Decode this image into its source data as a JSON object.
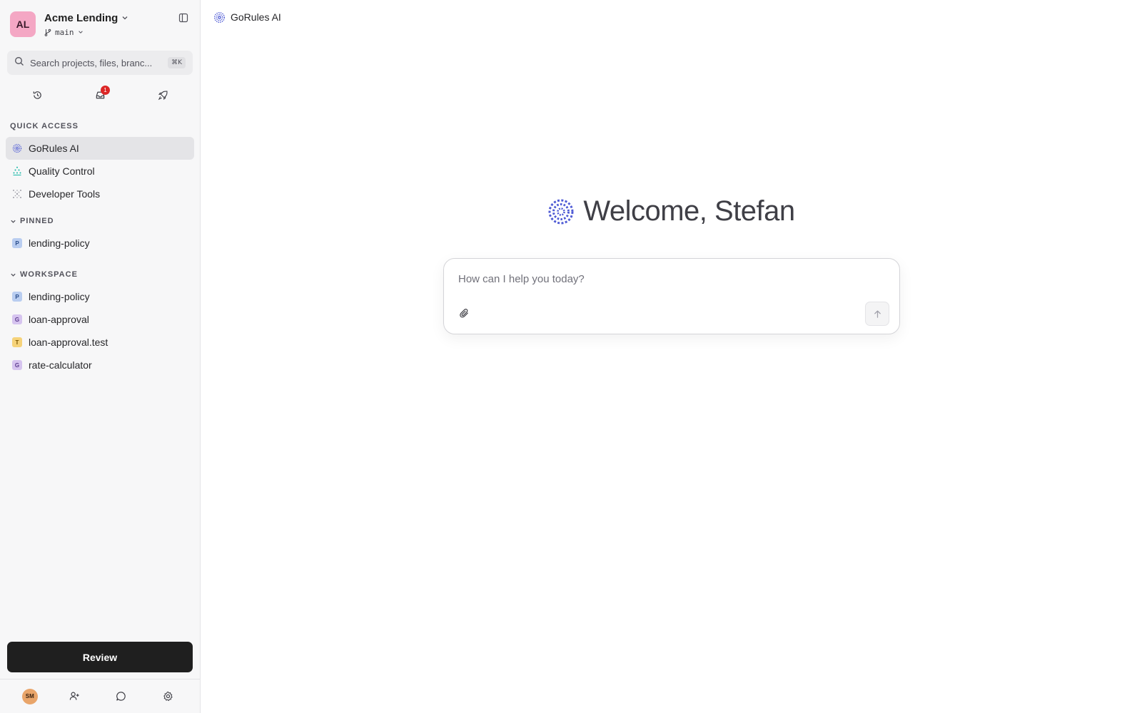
{
  "org": {
    "initials": "AL",
    "name": "Acme Lending",
    "branch": "main"
  },
  "search": {
    "placeholder": "Search projects, files, branc...",
    "shortcut": "⌘K"
  },
  "quick_icons": {
    "inbox_badge": "1"
  },
  "sections": {
    "quick_access": "QUICK ACCESS",
    "pinned": "PINNED",
    "workspace": "WORKSPACE"
  },
  "quick_access": [
    {
      "label": "GoRules AI",
      "icon": "gorules-ai-icon"
    },
    {
      "label": "Quality Control",
      "icon": "quality-control-icon"
    },
    {
      "label": "Developer Tools",
      "icon": "developer-tools-icon"
    }
  ],
  "pinned": [
    {
      "tag": "P",
      "label": "lending-policy"
    }
  ],
  "workspace": [
    {
      "tag": "P",
      "label": "lending-policy"
    },
    {
      "tag": "G",
      "label": "loan-approval"
    },
    {
      "tag": "T",
      "label": "loan-approval.test"
    },
    {
      "tag": "G",
      "label": "rate-calculator"
    }
  ],
  "review_label": "Review",
  "footer": {
    "user_initials": "SM"
  },
  "topbar": {
    "title": "GoRules AI"
  },
  "welcome": "Welcome, Stefan",
  "composer": {
    "placeholder": "How can I help you today?"
  },
  "colors": {
    "accent": "#4f5bd5",
    "badge": "#dc2626",
    "review_bg": "#1f1f1f"
  }
}
